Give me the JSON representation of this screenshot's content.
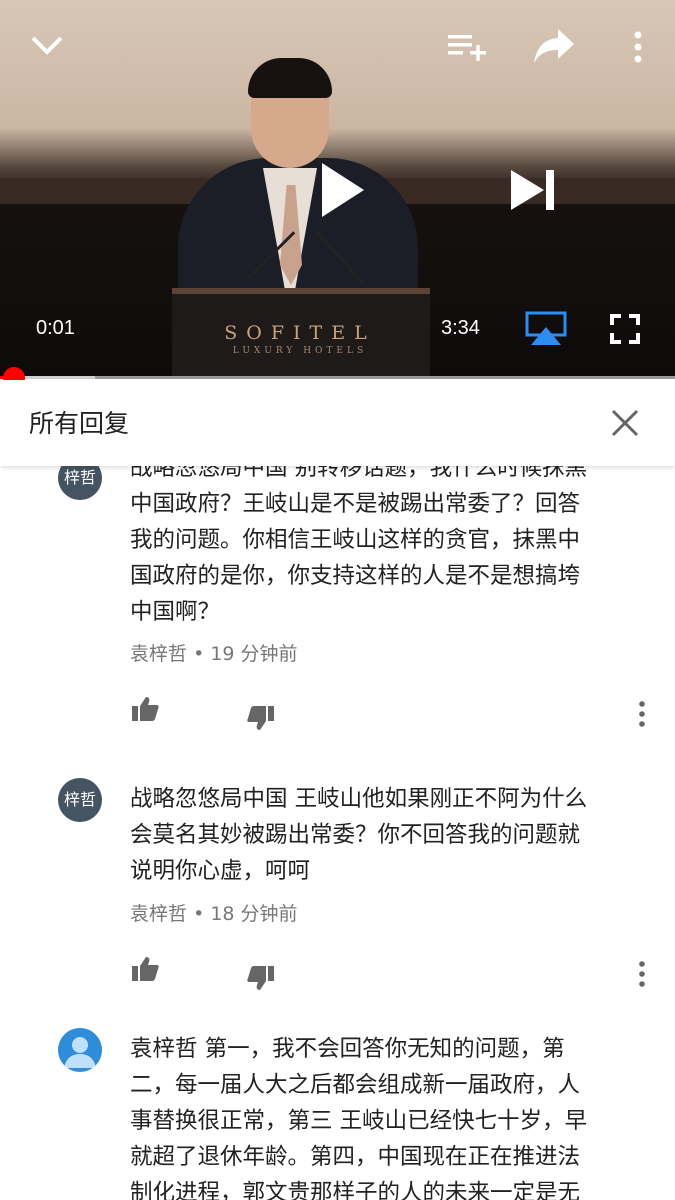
{
  "player": {
    "current_time": "0:01",
    "duration": "3:34",
    "progress_fraction": 0.005,
    "buffered_fraction": 0.14,
    "logo_text": "SOFITEL",
    "logo_subtext": "LUXURY HOTELS",
    "icons": [
      "chevron-down-icon",
      "add-to-playlist-icon",
      "share-icon",
      "more-vert-icon",
      "play-icon",
      "skip-next-icon",
      "airplay-icon",
      "fullscreen-icon"
    ],
    "accent_color": "#ff0000",
    "airplay_color": "#2e8bf0"
  },
  "replies_panel": {
    "title": "所有回复",
    "close_icon": "close-icon"
  },
  "comments": [
    {
      "avatar_text": "梓哲",
      "lines": [
        "战略忽悠局中国 别转移话题，我什么时候抹黑",
        "中国政府？王岐山是不是被踢出常委了？回答",
        "我的问题。你相信王岐山这样的贪官，抹黑中",
        "国政府的是你，你支持这样的人是不是想搞垮",
        "中国啊？"
      ],
      "author": "袁梓哲",
      "separator": "•",
      "time": "19 分钟前"
    },
    {
      "avatar_text": "梓哲",
      "lines": [
        "战略忽悠局中国 王岐山他如果刚正不阿为什么",
        "会莫名其妙被踢出常委？你不回答我的问题就",
        "说明你心虚，呵呵"
      ],
      "author": "袁梓哲",
      "separator": "•",
      "time": "18 分钟前"
    },
    {
      "avatar_icon": "user-avatar-icon",
      "lines": [
        "袁梓哲 第一，我不会回答你无知的问题，第",
        "二，每一届人大之后都会组成新一届政府，人",
        "事替换很正常，第三 王岐山已经快七十岁，早",
        "就超了退休年龄。第四，中国现在正在推进法",
        "制化进程，郭文贵那样子的人的未来一定是无"
      ]
    }
  ]
}
